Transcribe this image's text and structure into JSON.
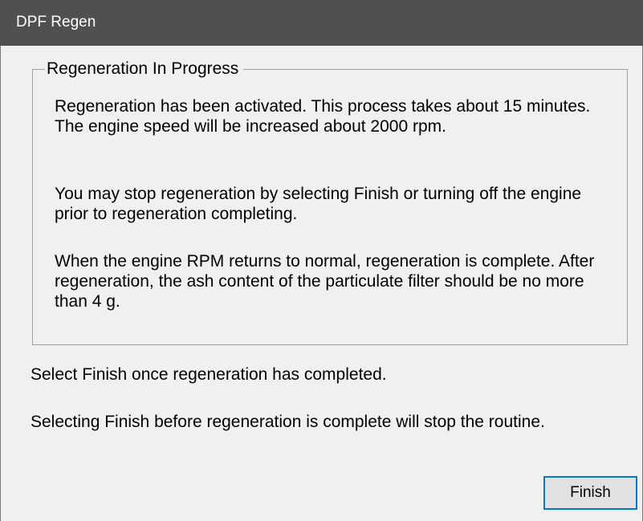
{
  "window": {
    "title": "DPF Regen"
  },
  "group": {
    "label": "Regeneration In Progress",
    "paragraphs": [
      "Regeneration has been activated.  This process takes about 15 minutes.  The engine speed will be increased about 2000 rpm.",
      "You may stop regeneration by selecting Finish or turning off the engine prior to regeneration completing.",
      "When the engine RPM returns to normal, regeneration is complete.  After regeneration, the ash content of the particulate filter should be no more than 4 g."
    ]
  },
  "instructions": [
    "Select Finish once regeneration has completed.",
    "Selecting Finish before regeneration is complete will stop the routine."
  ],
  "buttons": {
    "finish_label": "Finish"
  },
  "colors": {
    "titlebar": "#505050",
    "background": "#f0f0f0",
    "button_focus_border": "#0078d7"
  }
}
